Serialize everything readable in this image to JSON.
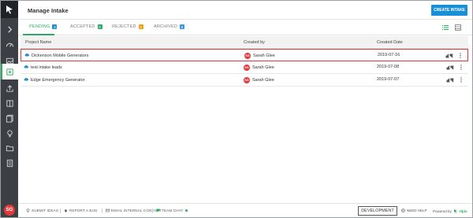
{
  "header": {
    "title": "Manage Intake",
    "create_label": "CREATE INTAKE"
  },
  "tabs": [
    {
      "label": "PENDING",
      "count": "3",
      "color": "#1a8fd9"
    },
    {
      "label": "ACCEPTED",
      "count": "0",
      "color": "#27ae60"
    },
    {
      "label": "REJECTED",
      "count": "0",
      "color": "#f39c12"
    },
    {
      "label": "ARCHIVED",
      "count": "0",
      "color": "#3498db"
    }
  ],
  "table": {
    "columns": [
      "Project Name",
      "Created by",
      "Created Date"
    ],
    "rows": [
      {
        "name": "Dickenson Mobile Generators",
        "creator_initials": "SG",
        "creator": "Sarah Glee",
        "date": "2019-07-16"
      },
      {
        "name": "test intake leads",
        "creator_initials": "SG",
        "creator": "Sarah Glee",
        "date": "2019-07-08"
      },
      {
        "name": "Edge Emergency Generator",
        "creator_initials": "SG",
        "creator": "Sarah Glee",
        "date": "2019-07-07"
      }
    ]
  },
  "sidebar": {
    "avatar_initials": "SG"
  },
  "footer": {
    "submit_ideas": "SUBMIT IDEAS",
    "report_bug": "REPORT A BUG",
    "email_contact": "EMAIL INTERNAL CONTACT",
    "team_chat": "TEAM CHAT",
    "environment": "DEVELOPMENT",
    "need_help": "NEED HELP",
    "powered_by": "Powered by",
    "brand": "rfpio"
  },
  "colors": {
    "accent": "#27ae60",
    "primary": "#1a8fd9",
    "highlight": "#d93a3a",
    "sidebar": "#3c3f44"
  }
}
